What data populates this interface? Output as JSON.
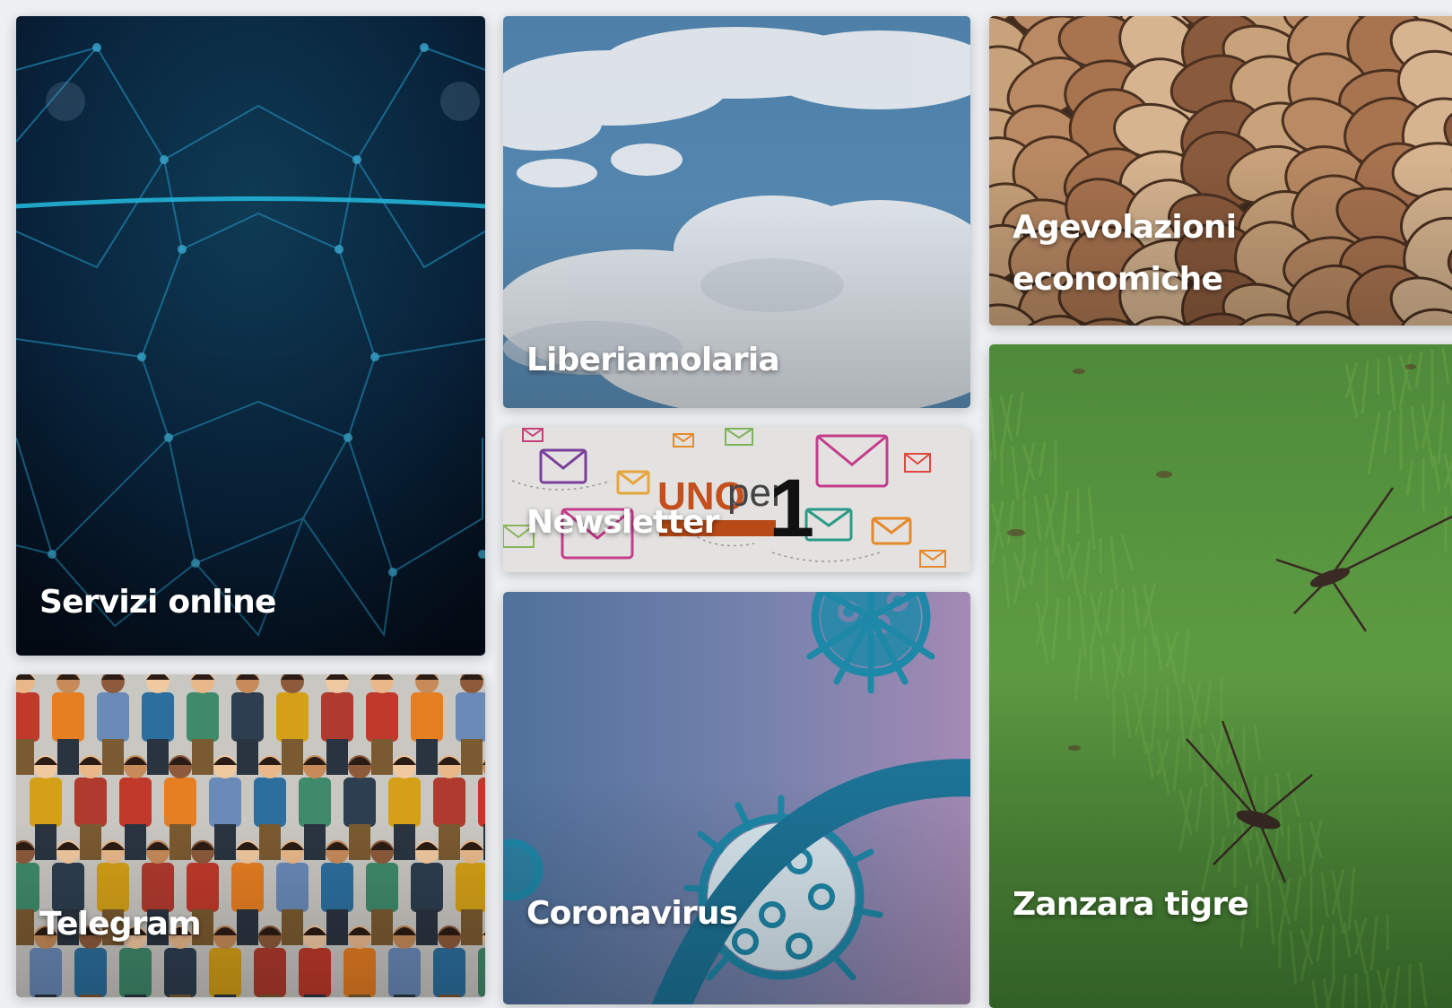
{
  "tiles": {
    "servizi": {
      "title": "Servizi online"
    },
    "liberia": {
      "title": "Liberiamolaria"
    },
    "newsletter": {
      "title": "Newsletter",
      "banner_uno": "UNO",
      "banner_per": "per",
      "banner_one": "1"
    },
    "corona": {
      "title": "Coronavirus"
    },
    "agevol": {
      "title": "Agevolazioni economiche"
    },
    "telegram": {
      "title": "Telegram"
    },
    "zanzara": {
      "title": "Zanzara tigre"
    }
  },
  "colors": {
    "page_bg": "#eef0f3",
    "title_text": "#ffffff",
    "newsletter_orange": "#b84a18"
  }
}
